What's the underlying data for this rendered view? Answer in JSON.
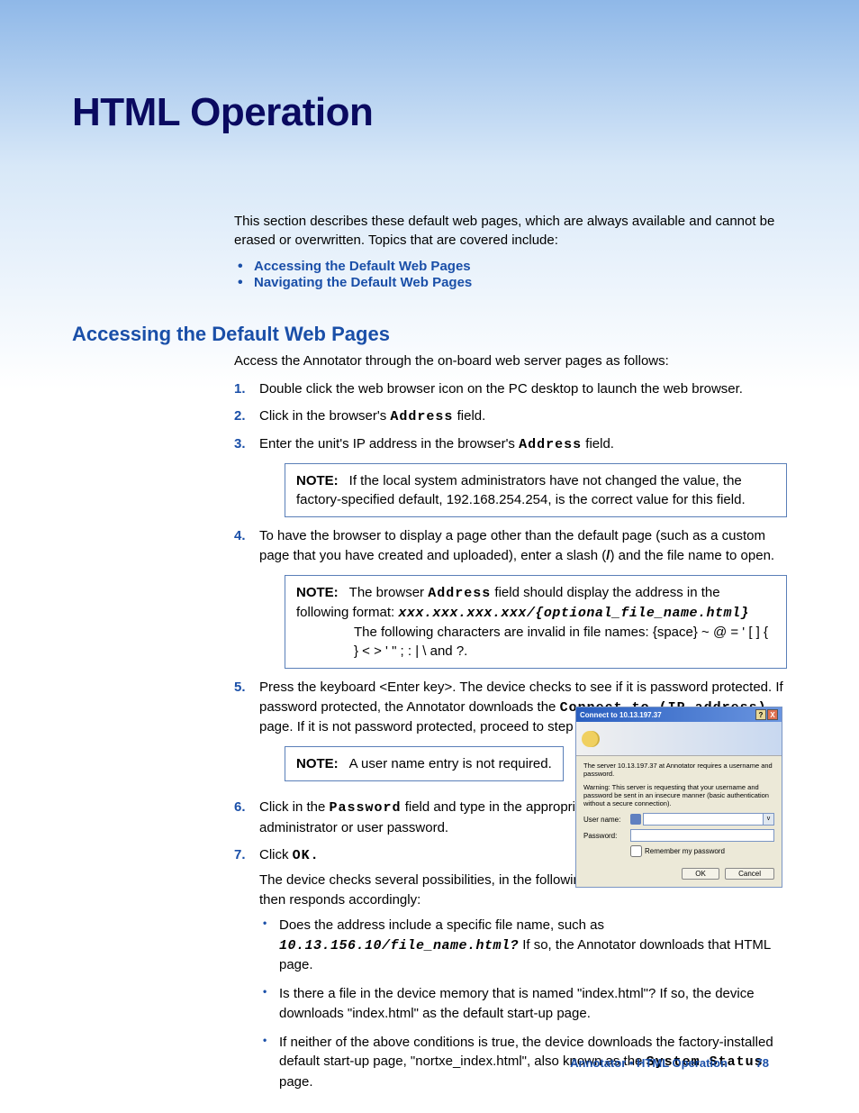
{
  "title": "HTML Operation",
  "intro": "This section describes these default web pages, which are always available and cannot be erased or overwritten. Topics that are covered include:",
  "links": {
    "l1": "Accessing the Default Web Pages",
    "l2": "Navigating the Default Web Pages"
  },
  "section_heading": "Accessing the Default Web Pages",
  "access_intro": "Access the Annotator through the on-board web server pages as follows:",
  "steps": {
    "s1": "Double click the web browser icon on the PC desktop to launch the web browser.",
    "s2_a": "Click in the browser's ",
    "s2_b": "Address",
    "s2_c": " field.",
    "s3_a": "Enter the unit's IP address in the browser's ",
    "s3_b": "Address",
    "s3_c": " field.",
    "s4_a": "To have the browser to display a page other than the default page (such as a custom page that you have created and uploaded), enter a slash (",
    "s4_b": "/",
    "s4_c": ") and the file name to open.",
    "s5_a": "Press the keyboard <Enter key>. The device checks to see if it is password protected. If password protected, the Annotator downloads the ",
    "s5_b": "Connect to (IP address)",
    "s5_c": " page. If it is not password protected, proceed to step 7.",
    "s6_a": "Click in the ",
    "s6_b": "Password",
    "s6_c": " field and type in the appropriate administrator or user password.",
    "s7_a": "Click ",
    "s7_b": "OK.",
    "s7_body": "The device checks several possibilities, in the following order, and then responds accordingly:"
  },
  "notes": {
    "label": "NOTE:",
    "n1": "If the local system administrators have not changed the value, the factory-specified default, 192.168.254.254, is the correct value for this field.",
    "n2_a": "The browser ",
    "n2_b": "Address",
    "n2_c": " field should display the address in the following format: ",
    "n2_d": "xxx.xxx.xxx.xxx/{optional_file_name.html}",
    "n2_e": "The following characters are invalid in file names: {space}  ~  @  =  '  [  ]  {  }  <  >  '  \"  ;  :  |  \\  and ?.",
    "n3": "A user name entry is not required."
  },
  "subs": {
    "b1_a": "Does the address include a specific file name, such as ",
    "b1_b": "10.13.156.10/file_name.html?",
    "b1_c": "  If so, the Annotator downloads that HTML page.",
    "b2": "Is there a file in the device memory that is named \"index.html\"? If so, the device downloads \"index.html\" as the default start-up page.",
    "b3_a": "If neither of the above conditions is true, the device downloads the factory-installed default start-up page, \"nortxe_index.html\", also known as the ",
    "b3_b": "System Status",
    "b3_c": " page."
  },
  "dialog": {
    "title": "Connect to 10.13.197.37",
    "msg1": "The server 10.13.197.37 at Annotator requires a username and password.",
    "msg2": "Warning: This server is requesting that your username and password be sent in an insecure manner (basic authentication without a secure connection).",
    "user_label": "User name:",
    "pass_label": "Password:",
    "remember": "Remember my password",
    "ok": "OK",
    "cancel": "Cancel"
  },
  "footer": {
    "text": "Annotator • HTML Operation",
    "page": "78"
  }
}
